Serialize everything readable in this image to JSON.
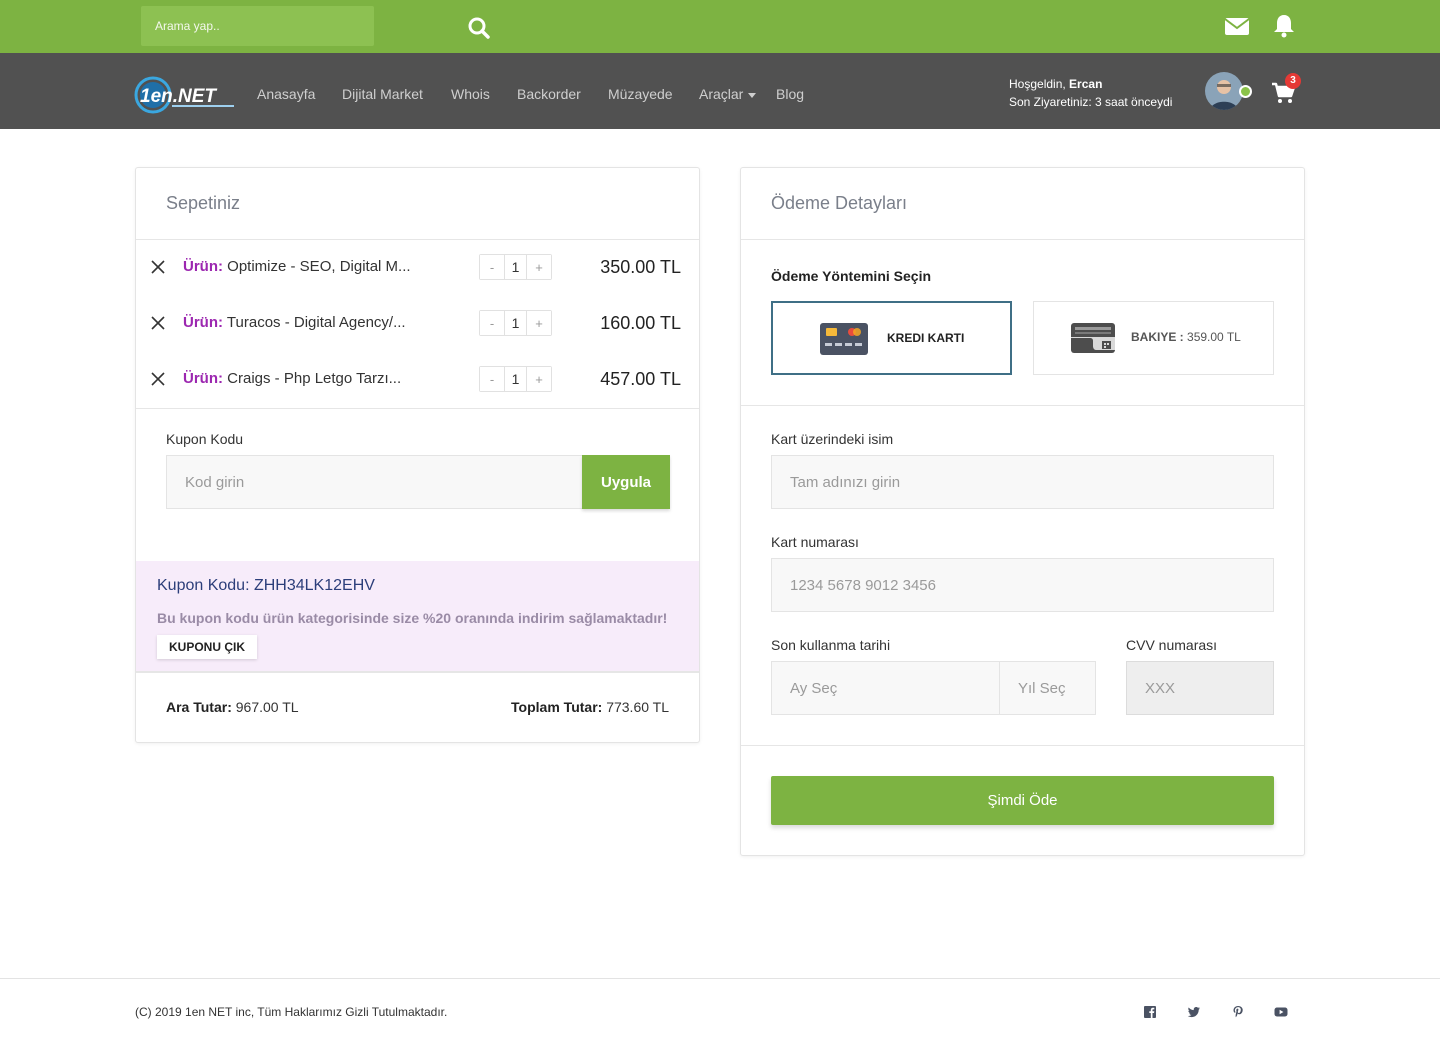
{
  "topbar": {
    "search_placeholder": "Arama yap..",
    "icons": [
      "search-icon",
      "envelope-icon",
      "bell-icon"
    ]
  },
  "nav": {
    "logo_text": "1en.NET",
    "items": [
      {
        "label": "Anasayfa"
      },
      {
        "label": "Dijital Market"
      },
      {
        "label": "Whois"
      },
      {
        "label": "Backorder"
      },
      {
        "label": "Müzayede"
      },
      {
        "label": "Araçlar"
      },
      {
        "label": "Blog"
      }
    ],
    "welcome_prefix": "Hoşgeldin,",
    "user_name": "Ercan",
    "last_visit": "Son Ziyaretiniz: 3 saat önceydi",
    "cart_count": "3"
  },
  "cart": {
    "title": "Sepetiniz",
    "item_label": "Ürün:",
    "items": [
      {
        "name": "Optimize - SEO, Digital M...",
        "qty": "1",
        "price": "350.00 TL"
      },
      {
        "name": "Turacos - Digital Agency/...",
        "qty": "1",
        "price": "160.00 TL"
      },
      {
        "name": "Craigs - Php Letgo Tarzı...",
        "qty": "1",
        "price": "457.00 TL"
      }
    ],
    "qty_minus": "-",
    "qty_plus": "+",
    "coupon_label": "Kupon Kodu",
    "coupon_placeholder": "Kod girin",
    "apply_label": "Uygula",
    "applied_coupon": "Kupon Kodu: ZHH34LK12EHV",
    "coupon_desc": "Bu kupon kodu ürün kategorisinde size %20 oranında indirim sağlamaktadır!",
    "remove_coupon_label": "KUPONU ÇIK",
    "subtotal_label": "Ara Tutar:",
    "subtotal_value": "967.00 TL",
    "total_label": "Toplam Tutar:",
    "total_value": "773.60 TL"
  },
  "payment": {
    "title": "Ödeme Detayları",
    "method_title": "Ödeme Yöntemini Seçin",
    "methods": [
      {
        "label": "KREDI KARTI",
        "icon": "credit-card-icon",
        "selected": true
      },
      {
        "label": "BAKIYE :",
        "amount": "359.00 TL",
        "icon": "wallet-icon",
        "selected": false
      }
    ],
    "name_label": "Kart üzerindeki isim",
    "name_placeholder": "Tam adınızı girin",
    "number_label": "Kart numarası",
    "number_placeholder": "1234 5678 9012 3456",
    "expiry_label": "Son kullanma tarihi",
    "month_placeholder": "Ay Seç",
    "year_placeholder": "Yıl Seç",
    "cvv_label": "CVV numarası",
    "cvv_placeholder": "XXX",
    "pay_label": "Şimdi Öde"
  },
  "footer": {
    "copyright": "(C) 2019 1en NET inc, Tüm Haklarımız Gizli Tutulmaktadır.",
    "social": [
      "facebook-icon",
      "twitter-icon",
      "pinterest-icon",
      "youtube-icon"
    ]
  },
  "colors": {
    "brand_green": "#7db342",
    "nav_gray": "#515151",
    "label_purple": "#9c27b0",
    "coupon_bg": "#f7ecfa",
    "badge_red": "#e53935"
  }
}
